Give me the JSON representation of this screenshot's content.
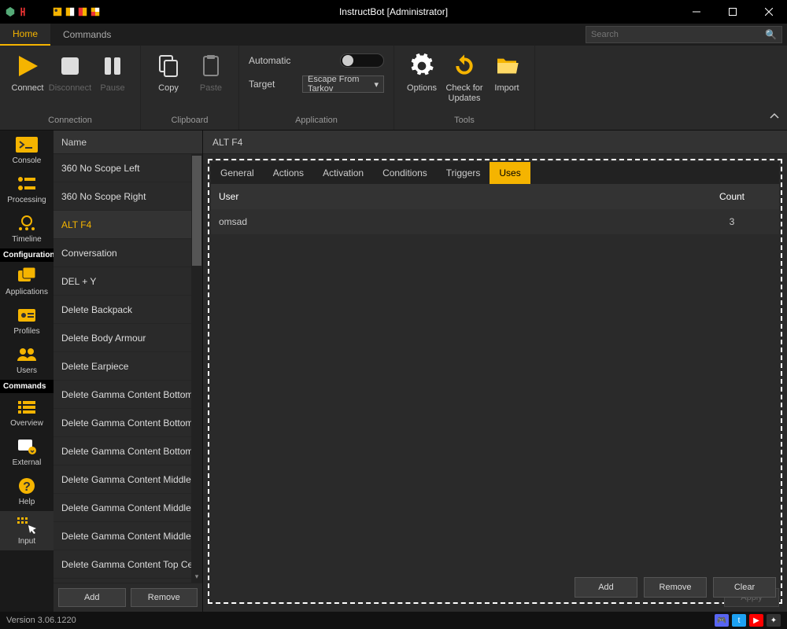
{
  "window": {
    "title": "InstructBot [Administrator]"
  },
  "menubar": {
    "tabs": [
      "Home",
      "Commands"
    ],
    "active": 0,
    "search_placeholder": "Search"
  },
  "ribbon": {
    "groups": {
      "connection": {
        "label": "Connection",
        "buttons": {
          "connect": "Connect",
          "disconnect": "Disconnect",
          "pause": "Pause"
        }
      },
      "clipboard": {
        "label": "Clipboard",
        "buttons": {
          "copy": "Copy",
          "paste": "Paste"
        }
      },
      "application": {
        "label": "Application",
        "automatic": "Automatic",
        "target": "Target",
        "target_value": "Escape From Tarkov"
      },
      "tools": {
        "label": "Tools",
        "buttons": {
          "options": "Options",
          "updates": "Check for\nUpdates",
          "import": "Import"
        }
      }
    }
  },
  "vnav": {
    "top": [
      {
        "label": "Console"
      },
      {
        "label": "Processing"
      },
      {
        "label": "Timeline"
      }
    ],
    "headers": [
      "Configuration",
      "Commands"
    ],
    "config": [
      {
        "label": "Applications"
      },
      {
        "label": "Profiles"
      },
      {
        "label": "Users"
      }
    ],
    "cmds": [
      {
        "label": "Overview"
      },
      {
        "label": "External"
      },
      {
        "label": "Help"
      },
      {
        "label": "Input"
      }
    ]
  },
  "commands": {
    "header": "Name",
    "items": [
      "360 No Scope Left",
      "360 No Scope Right",
      "ALT F4",
      "Conversation",
      "DEL + Y",
      "Delete Backpack",
      "Delete Body Armour",
      "Delete Earpiece",
      "Delete Gamma Content Bottom ...",
      "Delete Gamma Content Bottom ...",
      "Delete Gamma Content Bottom ...",
      "Delete Gamma Content Middle ...",
      "Delete Gamma Content Middle L...",
      "Delete Gamma Content Middle ...",
      "Delete Gamma Content Top Ce..."
    ],
    "selected": 2,
    "actions": {
      "add": "Add",
      "remove": "Remove"
    }
  },
  "detail": {
    "title": "ALT F4",
    "tabs": [
      "General",
      "Actions",
      "Activation",
      "Conditions",
      "Triggers",
      "Uses"
    ],
    "active_tab": 5,
    "uses": {
      "head": {
        "user": "User",
        "count": "Count"
      },
      "rows": [
        {
          "user": "omsad",
          "count": "3"
        }
      ]
    },
    "actions": {
      "add": "Add",
      "remove": "Remove",
      "clear": "Clear"
    },
    "apply": "Apply"
  },
  "statusbar": {
    "version": "Version 3.06.1220"
  }
}
